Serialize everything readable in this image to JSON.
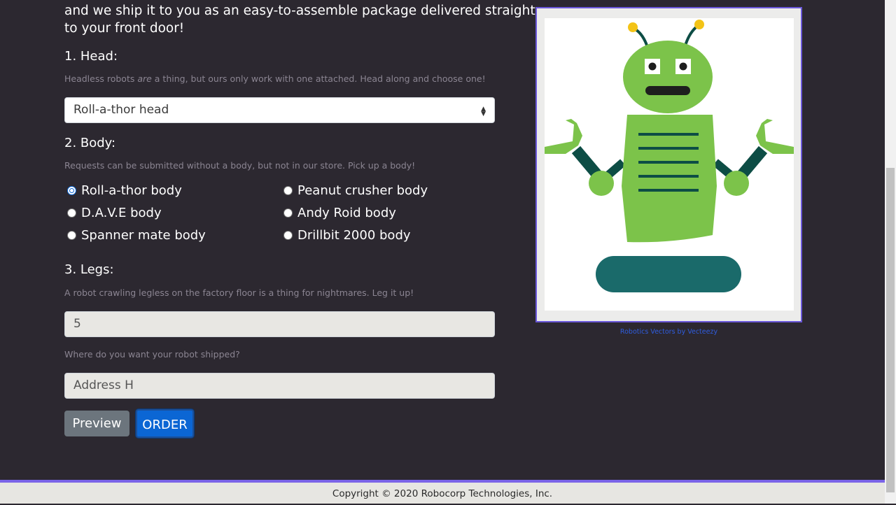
{
  "intro": {
    "line1": "and we ship it to you as an easy-to-assemble package delivered straight",
    "line2": "to your front door!"
  },
  "head": {
    "title": "1. Head:",
    "hint_pre": "Headless robots ",
    "hint_em": "are",
    "hint_post": " a thing, but ours only work with one attached. Head along and choose one!",
    "selected": "Roll-a-thor head"
  },
  "body": {
    "title": "2. Body:",
    "hint": "Requests can be submitted without a body, but not in our store. Pick up a body!",
    "options": [
      {
        "label": "Roll-a-thor body",
        "checked": true
      },
      {
        "label": "Peanut crusher body",
        "checked": false
      },
      {
        "label": "D.A.V.E body",
        "checked": false
      },
      {
        "label": "Andy Roid body",
        "checked": false
      },
      {
        "label": "Spanner mate body",
        "checked": false
      },
      {
        "label": "Drillbit 2000 body",
        "checked": false
      }
    ]
  },
  "legs": {
    "title": "3. Legs:",
    "hint": "A robot crawling legless on the factory floor is a thing for nightmares. Leg it up!",
    "value": "5"
  },
  "address": {
    "hint": "Where do you want your robot shipped?",
    "value": "Address H"
  },
  "buttons": {
    "preview": "Preview",
    "order": "ORDER"
  },
  "preview_image": {
    "credit": "Robotics Vectors by Vecteezy"
  },
  "footer": {
    "text": "Copyright © 2020 Robocorp Technologies, Inc."
  },
  "colors": {
    "background": "#2c2830",
    "accent": "#6b58d9",
    "robot_green": "#7cc34a",
    "robot_dark": "#0d4d45",
    "wheel": "#1a6a6a",
    "order_button": "#0b66d4"
  }
}
